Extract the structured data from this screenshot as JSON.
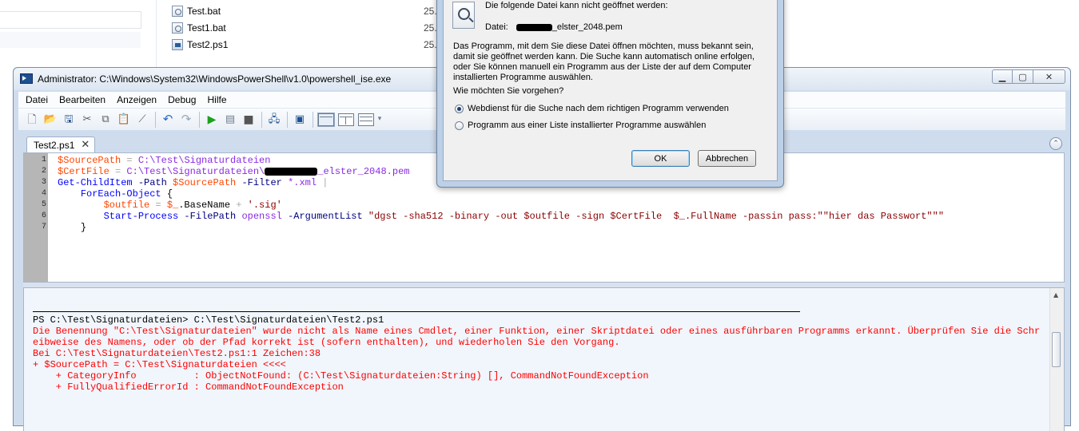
{
  "explorer": {
    "files": [
      {
        "name": "Test.bat",
        "date": "25."
      },
      {
        "name": "Test1.bat",
        "date": "25."
      },
      {
        "name": "Test2.ps1",
        "date": "25."
      }
    ]
  },
  "ise": {
    "title": "Administrator: C:\\Windows\\System32\\WindowsPowerShell\\v1.0\\powershell_ise.exe",
    "menu": [
      "Datei",
      "Bearbeiten",
      "Anzeigen",
      "Debug",
      "Hilfe"
    ],
    "tab_label": "Test2.ps1",
    "line_numbers": [
      "1",
      "2",
      "3",
      "4",
      "5",
      "6",
      "7"
    ],
    "code": {
      "l1_var": "$SourcePath",
      "l1_op": " = ",
      "l1_val": "C:\\Test\\Signaturdateien",
      "l2_var": "$CertFile",
      "l2_op": " = ",
      "l2_val_a": "C:\\Test\\Signaturdateien\\",
      "l2_val_b": "_elster_2048.pem",
      "l3_cmd": "Get-ChildItem",
      "l3_p1": " -Path ",
      "l3_var": "$SourcePath",
      "l3_p2": " -Filter ",
      "l3_val": "*.xml",
      "l3_pipe": " |",
      "l4_cmd": "ForEach-Object",
      "l4_brace": " {",
      "l5_var": "$outfile",
      "l5_op1": " = ",
      "l5_var2": "$_",
      "l5_mem": ".BaseName",
      "l5_op2": " + ",
      "l5_str": "'.sig'",
      "l6_cmd": "Start-Process",
      "l6_p1": " -FilePath ",
      "l6_arg": "openssl",
      "l6_p2": " -ArgumentList ",
      "l6_str": "\"dgst -sha512 -binary -out $outfile -sign $CertFile  $_.FullName -passin pass:\"\"hier das Passwort\"\"\"",
      "l7_brace": "}"
    },
    "console": {
      "prompt_line": "PS C:\\Test\\Signaturdateien> C:\\Test\\Signaturdateien\\Test2.ps1",
      "error_lines": [
        "Die Benennung \"C:\\Test\\Signaturdateien\" wurde nicht als Name eines Cmdlet, einer Funktion, einer Skriptdatei oder eines ausführbaren Programms erkannt. Überprüfen Sie die Schr",
        "eibweise des Namens, oder ob der Pfad korrekt ist (sofern enthalten), und wiederholen Sie den Vorgang.",
        "Bei C:\\Test\\Signaturdateien\\Test2.ps1:1 Zeichen:38",
        "+ $SourcePath = C:\\Test\\Signaturdateien <<<<",
        "    + CategoryInfo          : ObjectNotFound: (C:\\Test\\Signaturdateien:String) [], CommandNotFoundException",
        "    + FullyQualifiedErrorId : CommandNotFoundException"
      ]
    }
  },
  "dialog": {
    "headline": "Die folgende Datei kann nicht geöffnet werden:",
    "file_label": "Datei:",
    "file_name_visible": "_elster_2048.pem",
    "explanation": "Das Programm, mit dem Sie diese Datei öffnen möchten, muss bekannt sein, damit sie geöffnet werden kann. Die Suche kann automatisch online erfolgen, oder Sie können manuell ein Programm aus der Liste der auf dem Computer installierten Programme auswählen.",
    "question": "Wie möchten Sie vorgehen?",
    "options": [
      {
        "label": "Webdienst für die Suche nach dem richtigen Programm verwenden",
        "selected": true
      },
      {
        "label": "Programm aus einer Liste installierter Programme auswählen",
        "selected": false
      }
    ],
    "ok_label": "OK",
    "cancel_label": "Abbrechen"
  },
  "colors": {
    "variable": "#ff4500",
    "command": "#0000ff",
    "error_text": "#ff0000",
    "console_bg": "#f0f6fc"
  }
}
